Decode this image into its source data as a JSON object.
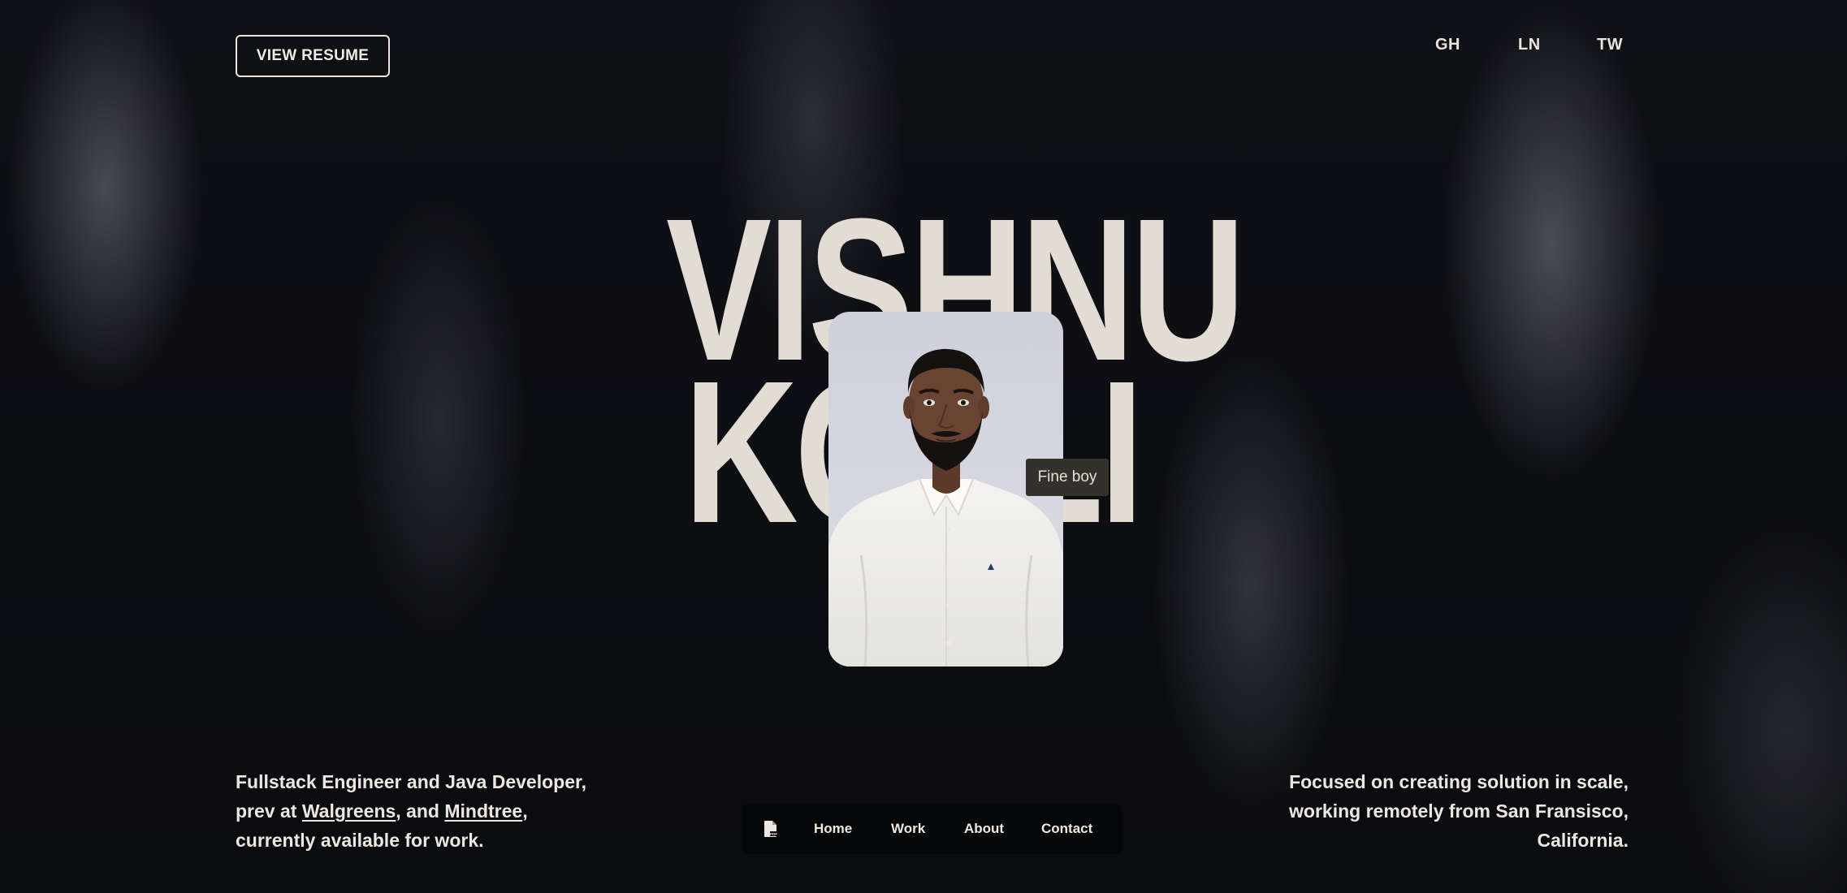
{
  "header": {
    "resume_label": "VIEW RESUME",
    "social": {
      "gh": "GH",
      "ln": "LN",
      "tw": "TW"
    }
  },
  "hero": {
    "first_name": "VISHNU",
    "last_name": "KOLLI",
    "photo_alt": "Profile photo",
    "tooltip": "Fine boy"
  },
  "bio": {
    "line1": "Fullstack Engineer and Java Developer,",
    "line2_prefix": "prev at ",
    "company1": "Walgreens",
    "between": ", and ",
    "company2": "Mindtree",
    "line2_suffix": ",",
    "line3": "currently available for work."
  },
  "focus": {
    "line1": "Focused on creating solution in scale,",
    "line2": "working remotely from San Fransisco,",
    "line3": "California."
  },
  "nav": {
    "pdf_icon": "pdf-file-icon",
    "items": [
      "Home",
      "Work",
      "About",
      "Contact"
    ]
  },
  "colors": {
    "background": "#0c0d12",
    "text": "#e9e4de",
    "name": "#e2dcd4",
    "nav_bg": "#050608",
    "tooltip_bg": "#33322a"
  }
}
